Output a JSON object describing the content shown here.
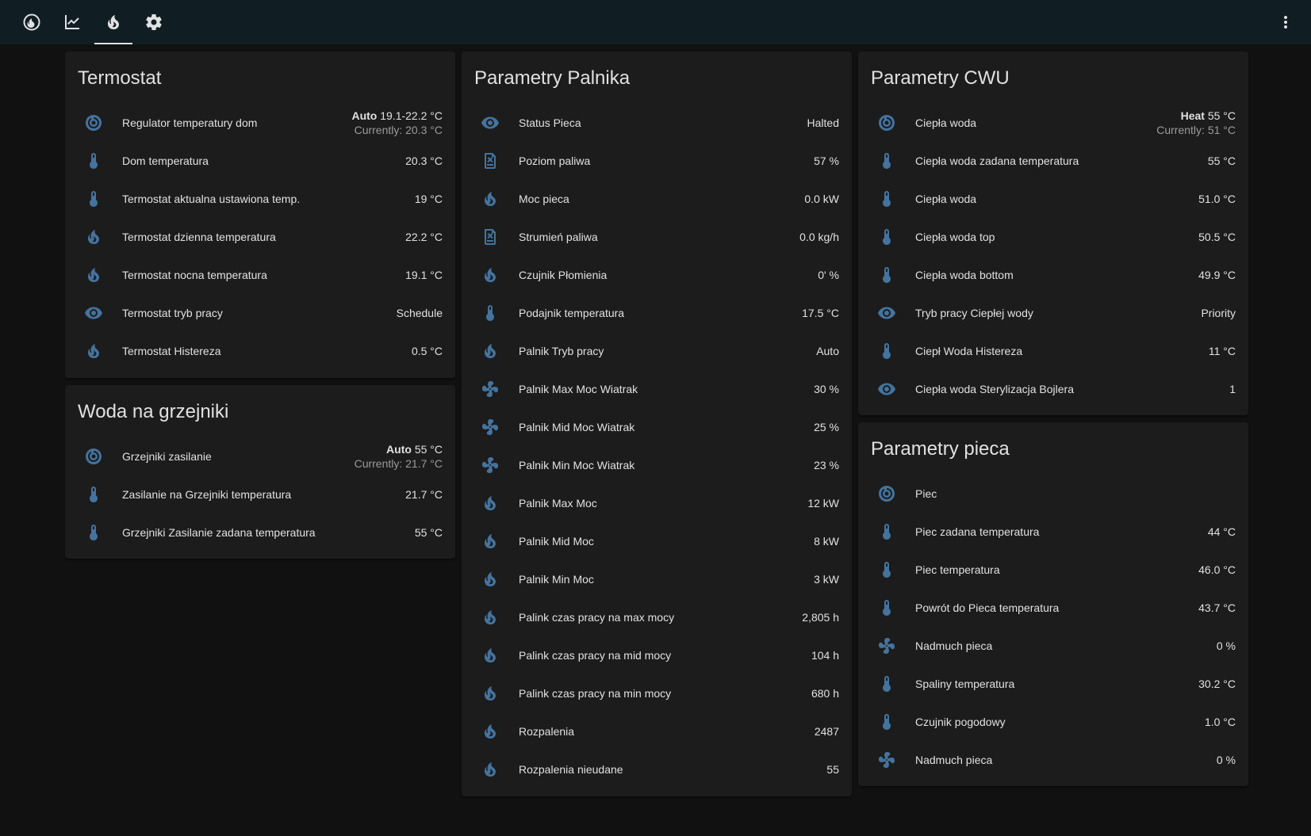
{
  "colors": {
    "icon": "#44739e",
    "background": "#111111",
    "card": "#1c1c1c",
    "topbar": "#101e24"
  },
  "topbar": {
    "tabs": [
      {
        "icon": "fire-circle-icon"
      },
      {
        "icon": "chart-line-icon"
      },
      {
        "icon": "fire-icon",
        "active": true
      },
      {
        "icon": "gear-icon"
      }
    ],
    "menu_icon": "dots-vertical-icon"
  },
  "termostat": {
    "title": "Termostat",
    "rows": [
      {
        "icon": "thermostat-icon",
        "label": "Regulator temperatury dom",
        "mode": "Auto",
        "value": "19.1-22.2 °C",
        "current": "Currently: 20.3 °C"
      },
      {
        "icon": "thermometer-icon",
        "label": "Dom temperatura",
        "value": "20.3 °C"
      },
      {
        "icon": "thermometer-icon",
        "label": "Termostat aktualna ustawiona temp.",
        "value": "19 °C"
      },
      {
        "icon": "fire-icon",
        "label": "Termostat dzienna temperatura",
        "value": "22.2 °C"
      },
      {
        "icon": "fire-icon",
        "label": "Termostat nocna temperatura",
        "value": "19.1 °C"
      },
      {
        "icon": "eye-icon",
        "label": "Termostat tryb pracy",
        "value": "Schedule"
      },
      {
        "icon": "fire-icon",
        "label": "Termostat Histereza",
        "value": "0.5 °C"
      }
    ]
  },
  "woda": {
    "title": "Woda na grzejniki",
    "rows": [
      {
        "icon": "thermostat-icon",
        "label": "Grzejniki zasilanie",
        "mode": "Auto",
        "value": "55 °C",
        "current": "Currently: 21.7 °C"
      },
      {
        "icon": "thermometer-icon",
        "label": "Zasilanie na Grzejniki temperatura",
        "value": "21.7 °C"
      },
      {
        "icon": "thermometer-icon",
        "label": "Grzejniki Zasilanie zadana temperatura",
        "value": "55 °C"
      }
    ]
  },
  "palnik": {
    "title": "Parametry Palnika",
    "rows": [
      {
        "icon": "eye-icon",
        "label": "Status Pieca",
        "value": "Halted"
      },
      {
        "icon": "fuel-icon",
        "label": "Poziom paliwa",
        "value": "57 %"
      },
      {
        "icon": "fire-icon",
        "label": "Moc pieca",
        "value": "0.0 kW"
      },
      {
        "icon": "fuel-icon",
        "label": "Strumień paliwa",
        "value": "0.0 kg/h"
      },
      {
        "icon": "fire-icon",
        "label": "Czujnik Płomienia",
        "value": "0' %"
      },
      {
        "icon": "thermometer-icon",
        "label": "Podajnik temperatura",
        "value": "17.5 °C"
      },
      {
        "icon": "fire-icon",
        "label": "Palnik Tryb pracy",
        "value": "Auto"
      },
      {
        "icon": "fan-icon",
        "label": "Palnik Max Moc Wiatrak",
        "value": "30 %"
      },
      {
        "icon": "fan-icon",
        "label": "Palnik Mid Moc Wiatrak",
        "value": "25 %"
      },
      {
        "icon": "fan-icon",
        "label": "Palnik Min Moc Wiatrak",
        "value": "23 %"
      },
      {
        "icon": "fire-icon",
        "label": "Palnik Max Moc",
        "value": "12 kW"
      },
      {
        "icon": "fire-icon",
        "label": "Palnik Mid Moc",
        "value": "8 kW"
      },
      {
        "icon": "fire-icon",
        "label": "Palnik Min Moc",
        "value": "3 kW"
      },
      {
        "icon": "fire-icon",
        "label": "Palink czas pracy na max mocy",
        "value": "2,805 h"
      },
      {
        "icon": "fire-icon",
        "label": "Palink czas pracy na mid mocy",
        "value": "104 h"
      },
      {
        "icon": "fire-icon",
        "label": "Palink czas pracy na min mocy",
        "value": "680 h"
      },
      {
        "icon": "fire-icon",
        "label": "Rozpalenia",
        "value": "2487"
      },
      {
        "icon": "fire-icon",
        "label": "Rozpalenia nieudane",
        "value": "55"
      }
    ]
  },
  "cwu": {
    "title": "Parametry CWU",
    "rows": [
      {
        "icon": "thermostat-icon",
        "label": "Ciepła woda",
        "mode": "Heat",
        "value": "55 °C",
        "current": "Currently: 51 °C"
      },
      {
        "icon": "thermometer-icon",
        "label": "Ciepła woda zadana temperatura",
        "value": "55 °C"
      },
      {
        "icon": "thermometer-icon",
        "label": "Ciepła woda",
        "value": "51.0 °C"
      },
      {
        "icon": "thermometer-icon",
        "label": "Ciepła woda top",
        "value": "50.5 °C"
      },
      {
        "icon": "thermometer-icon",
        "label": "Ciepła woda bottom",
        "value": "49.9 °C"
      },
      {
        "icon": "eye-icon",
        "label": "Tryb pracy Ciepłej wody",
        "value": "Priority"
      },
      {
        "icon": "thermometer-icon",
        "label": "Ciepł Woda Histereza",
        "value": "11 °C"
      },
      {
        "icon": "eye-icon",
        "label": "Ciepła woda Sterylizacja Bojlera",
        "value": "1"
      }
    ]
  },
  "piec": {
    "title": "Parametry pieca",
    "rows": [
      {
        "icon": "thermostat-icon",
        "label": "Piec",
        "value": ""
      },
      {
        "icon": "thermometer-icon",
        "label": "Piec zadana temperatura",
        "value": "44 °C"
      },
      {
        "icon": "thermometer-icon",
        "label": "Piec temperatura",
        "value": "46.0 °C"
      },
      {
        "icon": "thermometer-icon",
        "label": "Powrót do Pieca temperatura",
        "value": "43.7 °C"
      },
      {
        "icon": "fan-icon",
        "label": "Nadmuch pieca",
        "value": "0 %"
      },
      {
        "icon": "thermometer-icon",
        "label": "Spaliny temperatura",
        "value": "30.2 °C"
      },
      {
        "icon": "thermometer-icon",
        "label": "Czujnik pogodowy",
        "value": "1.0 °C"
      },
      {
        "icon": "fan-icon",
        "label": "Nadmuch pieca",
        "value": "0 %"
      }
    ]
  }
}
